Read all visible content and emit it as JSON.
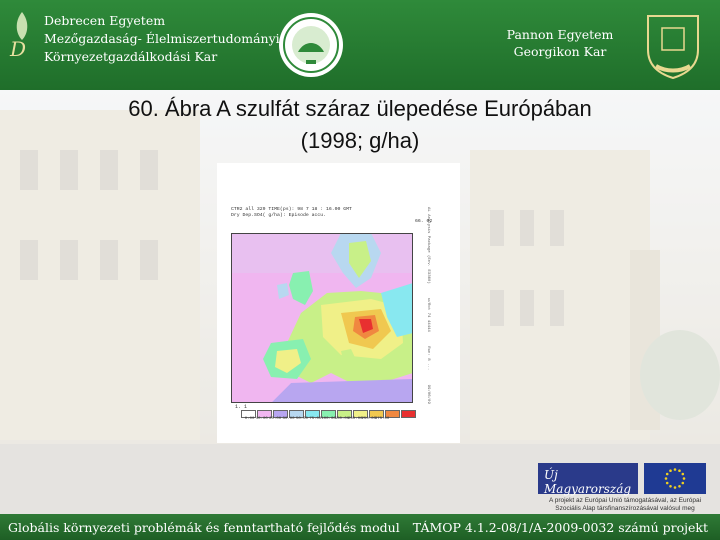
{
  "header": {
    "left_university": [
      "Debrecen Egyetem",
      "Mezőgazdaság- Élelmiszertudományi és",
      "Környezetgazdálkodási Kar"
    ],
    "right_university": [
      "Pannon Egyetem",
      "Georgikon Kar"
    ]
  },
  "slide": {
    "title_lines": [
      "60. Ábra A szulfát száraz ülepedése Európában",
      "(1998; g/ha)"
    ]
  },
  "figure": {
    "header_lines": [
      "CTR2 all 329  TIME(ps): 98  7 18 : 16.00 GMT",
      "Dry Dep.SO4( g/ha): Episode accu."
    ],
    "corner_text": "66. 02",
    "side_text": [
      "AL Analysis Package (Env. E3360)",
      "w/Rot 74 44444",
      "Run: 8 ...",
      "99/06/09"
    ],
    "legend_id": "1. 1",
    "legend_colors": [
      "#ffffff",
      "#f0b6f0",
      "#b8a6f0",
      "#b8d8f0",
      "#88e8f0",
      "#88f0b0",
      "#c8f088",
      "#f0f088",
      "#f0c850",
      "#f08840",
      "#e83030"
    ],
    "legend_labels": [
      "0.00",
      "10.00",
      "20.00",
      "30.00",
      "50.00",
      "75.00",
      "100.00",
      "150.00",
      "200.00",
      "250.00",
      "375.00"
    ]
  },
  "footer": {
    "left": "Globális környezeti problémák és fenntartható fejlődés modul",
    "right": "TÁMOP 4.1.2-08/1/A-2009-0032 számú projekt"
  },
  "sponsor": {
    "logo_text": "Új Magyarország",
    "note_lines": [
      "A projekt az Európai Unió támogatásával, az Európai",
      "Szociális Alap társfinanszírozásával valósul meg"
    ]
  }
}
